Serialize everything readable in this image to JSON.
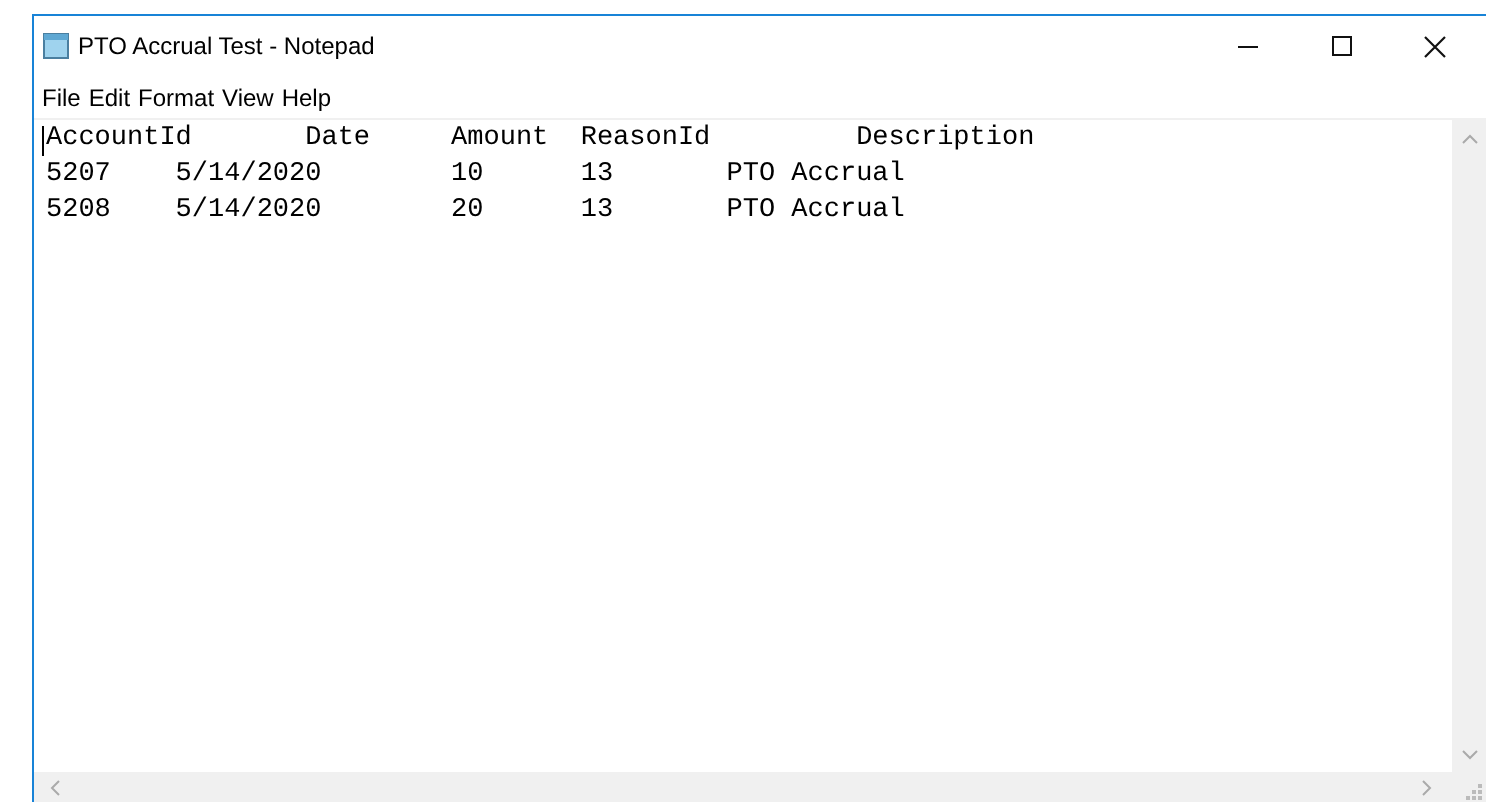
{
  "window": {
    "title": "PTO Accrual Test - Notepad"
  },
  "menu": [
    "File",
    "Edit",
    "Format",
    "View",
    "Help"
  ],
  "document": {
    "lines": [
      "AccountId       Date     Amount  ReasonId         Description",
      "5207    5/14/2020        10      13       PTO Accrual",
      "5208    5/14/2020        20      13       PTO Accrual"
    ]
  }
}
